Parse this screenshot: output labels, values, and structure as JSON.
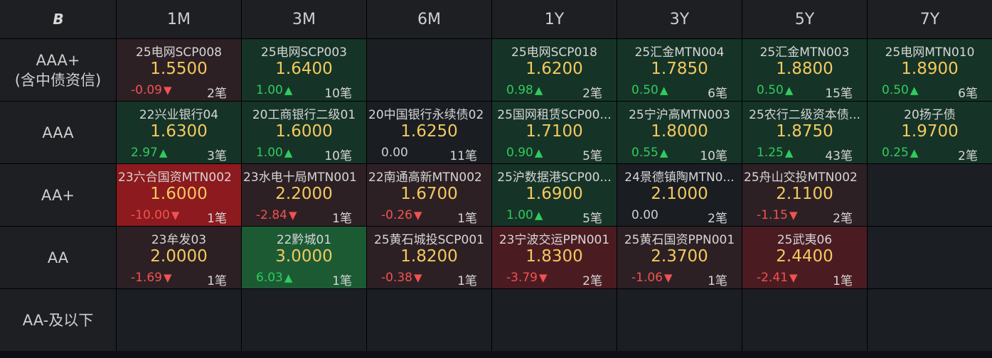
{
  "header": {
    "logo": "B",
    "tenors": [
      "1M",
      "3M",
      "6M",
      "1Y",
      "3Y",
      "5Y",
      "7Y"
    ]
  },
  "colors": {
    "rate": "#f3c95e",
    "up": "#2ecc5c",
    "down": "#f05252",
    "cell_green": "#163327",
    "cell_green_strong": "#1c5a34",
    "cell_red_light": "#2d2024",
    "cell_red_mid": "#4a1c22",
    "cell_red_strong": "#8c1a1e",
    "cell_neutral": "#1a1d22"
  },
  "ratings": [
    {
      "label": [
        "AAA+",
        "(含中债资信)"
      ],
      "cells": [
        {
          "name": "25电网SCP008",
          "rate": "1.5500",
          "change": "-0.09",
          "dir": "down",
          "count": "2笔",
          "tone": "red_light"
        },
        {
          "name": "25电网SCP003",
          "rate": "1.6400",
          "change": "1.00",
          "dir": "up",
          "count": "10笔",
          "tone": "green"
        },
        null,
        {
          "name": "25电网SCP018",
          "rate": "1.6200",
          "change": "0.98",
          "dir": "up",
          "count": "2笔",
          "tone": "green"
        },
        {
          "name": "25汇金MTN004",
          "rate": "1.7850",
          "change": "0.50",
          "dir": "up",
          "count": "6笔",
          "tone": "green"
        },
        {
          "name": "25汇金MTN003",
          "rate": "1.8800",
          "change": "0.50",
          "dir": "up",
          "count": "15笔",
          "tone": "green"
        },
        {
          "name": "25电网MTN010",
          "rate": "1.8900",
          "change": "0.50",
          "dir": "up",
          "count": "6笔",
          "tone": "green"
        }
      ]
    },
    {
      "label": [
        "AAA"
      ],
      "cells": [
        {
          "name": "22兴业银行04",
          "rate": "1.6300",
          "change": "2.97",
          "dir": "up",
          "count": "3笔",
          "tone": "green"
        },
        {
          "name": "20工商银行二级01",
          "rate": "1.6000",
          "change": "1.00",
          "dir": "up",
          "count": "10笔",
          "tone": "green"
        },
        {
          "name": "20中国银行永续债02",
          "rate": "1.6250",
          "change": "0.00",
          "dir": "flat",
          "count": "11笔",
          "tone": "neutral",
          "clip": true
        },
        {
          "name": "25国网租赁SCP00...",
          "rate": "1.7100",
          "change": "0.90",
          "dir": "up",
          "count": "5笔",
          "tone": "green"
        },
        {
          "name": "25宁沪高MTN003",
          "rate": "1.8000",
          "change": "0.55",
          "dir": "up",
          "count": "10笔",
          "tone": "green"
        },
        {
          "name": "25农行二级资本债...",
          "rate": "1.8750",
          "change": "1.25",
          "dir": "up",
          "count": "43笔",
          "tone": "green"
        },
        {
          "name": "20扬子债",
          "rate": "1.9700",
          "change": "0.25",
          "dir": "up",
          "count": "2笔",
          "tone": "green"
        }
      ]
    },
    {
      "label": [
        "AA+"
      ],
      "cells": [
        {
          "name": "23六合国资MTN002",
          "rate": "1.6000",
          "change": "-10.00",
          "dir": "down",
          "count": "1笔",
          "tone": "red_strong",
          "clip": true
        },
        {
          "name": "23水电十局MTN001",
          "rate": "2.2000",
          "change": "-2.84",
          "dir": "down",
          "count": "1笔",
          "tone": "red_light",
          "clip": true
        },
        {
          "name": "22南通高新MTN002",
          "rate": "1.6700",
          "change": "-0.26",
          "dir": "down",
          "count": "1笔",
          "tone": "red_light",
          "clip": true
        },
        {
          "name": "25沪数据港SCP00...",
          "rate": "1.6900",
          "change": "1.00",
          "dir": "up",
          "count": "5笔",
          "tone": "green"
        },
        {
          "name": "24景德镇陶MTN0...",
          "rate": "2.1000",
          "change": "0.00",
          "dir": "flat",
          "count": "2笔",
          "tone": "neutral"
        },
        {
          "name": "25舟山交投MTN002",
          "rate": "2.1100",
          "change": "-1.15",
          "dir": "down",
          "count": "2笔",
          "tone": "red_light",
          "clip": true
        },
        null
      ]
    },
    {
      "label": [
        "AA"
      ],
      "cells": [
        {
          "name": "23牟发03",
          "rate": "2.0000",
          "change": "-1.69",
          "dir": "down",
          "count": "1笔",
          "tone": "red_light"
        },
        {
          "name": "22黔城01",
          "rate": "3.0000",
          "change": "6.03",
          "dir": "up",
          "count": "1笔",
          "tone": "green_strong"
        },
        {
          "name": "25黄石城投SCP001",
          "rate": "1.8200",
          "change": "-0.38",
          "dir": "down",
          "count": "1笔",
          "tone": "red_light"
        },
        {
          "name": "23宁波交运PPN001",
          "rate": "1.8300",
          "change": "-3.79",
          "dir": "down",
          "count": "2笔",
          "tone": "red_mid"
        },
        {
          "name": "25黄石国资PPN001",
          "rate": "2.3700",
          "change": "-1.06",
          "dir": "down",
          "count": "1笔",
          "tone": "red_light"
        },
        {
          "name": "25武夷06",
          "rate": "2.4400",
          "change": "-2.41",
          "dir": "down",
          "count": "1笔",
          "tone": "red_mid"
        },
        null
      ]
    },
    {
      "label": [
        "AA-及以下"
      ],
      "cells": [
        null,
        null,
        null,
        null,
        null,
        null,
        null
      ]
    }
  ]
}
